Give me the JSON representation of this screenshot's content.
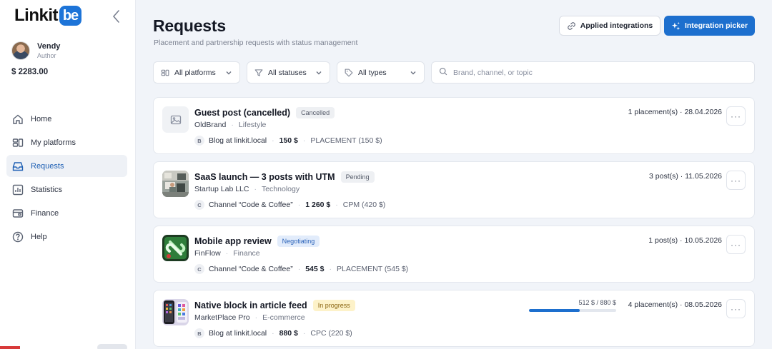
{
  "app": {
    "logo_text": "Linkit",
    "logo_badge": "be"
  },
  "user": {
    "name": "Vendy",
    "role": "Author",
    "balance": "$ 2283.00"
  },
  "nav": [
    {
      "label": "Home",
      "icon": "home-icon",
      "active": false
    },
    {
      "label": "My platforms",
      "icon": "platforms-icon",
      "active": false
    },
    {
      "label": "Requests",
      "icon": "inbox-icon",
      "active": true
    },
    {
      "label": "Statistics",
      "icon": "bar-chart-icon",
      "active": false
    },
    {
      "label": "Finance",
      "icon": "wallet-icon",
      "active": false
    },
    {
      "label": "Help",
      "icon": "help-icon",
      "active": false
    }
  ],
  "page": {
    "title": "Requests",
    "subtitle": "Placement and partnership requests with status management"
  },
  "header_buttons": {
    "applied": "Applied integrations",
    "picker": "Integration picker"
  },
  "filters": {
    "platforms": "All platforms",
    "statuses": "All statuses",
    "types": "All types",
    "search_placeholder": "Brand, channel, or topic",
    "search_value": ""
  },
  "requests": [
    {
      "title": "Guest post (cancelled)",
      "status": "Cancelled",
      "brand": "OldBrand",
      "category": "Lifestyle",
      "channel_initial": "B",
      "channel": "Blog at linkit.local",
      "price": "150 $",
      "model": "PLACEMENT (150 $)",
      "meta": "1 placement(s) · 28.04.2026",
      "thumb": "image-placeholder"
    },
    {
      "title": "SaaS launch — 3 posts with UTM",
      "status": "Pending",
      "brand": "Startup Lab LLC",
      "category": "Technology",
      "channel_initial": "C",
      "channel": "Channel “Code & Coffee”",
      "price": "1 260 $",
      "model": "CPM (420 $)",
      "meta": "3 post(s) · 11.05.2026",
      "thumb": "office-photo"
    },
    {
      "title": "Mobile app review",
      "status": "Negotiating",
      "brand": "FinFlow",
      "category": "Finance",
      "channel_initial": "C",
      "channel": "Channel “Code & Coffee”",
      "price": "545 $",
      "model": "PLACEMENT (545 $)",
      "meta": "1 post(s) · 10.05.2026",
      "thumb": "finflow-logo"
    },
    {
      "title": "Native block in article feed",
      "status": "In progress",
      "brand": "MarketPlace Pro",
      "category": "E-commerce",
      "channel_initial": "B",
      "channel": "Blog at linkit.local",
      "price": "880 $",
      "model": "CPC (220 $)",
      "meta": "4 placement(s) · 08.05.2026",
      "progress_label": "512 $ / 880 $",
      "progress_fraction": 0.582,
      "thumb": "phone-apps"
    }
  ],
  "colors": {
    "accent": "#1d6fce",
    "badge_cancelled_bg": "#eef0f3",
    "badge_pending_bg": "#eef0f3",
    "badge_negotiating_bg": "#e2ecfb",
    "badge_negotiating_fg": "#2a62b8",
    "badge_inprogress_bg": "#fdf2c9",
    "badge_inprogress_fg": "#8a6410"
  }
}
